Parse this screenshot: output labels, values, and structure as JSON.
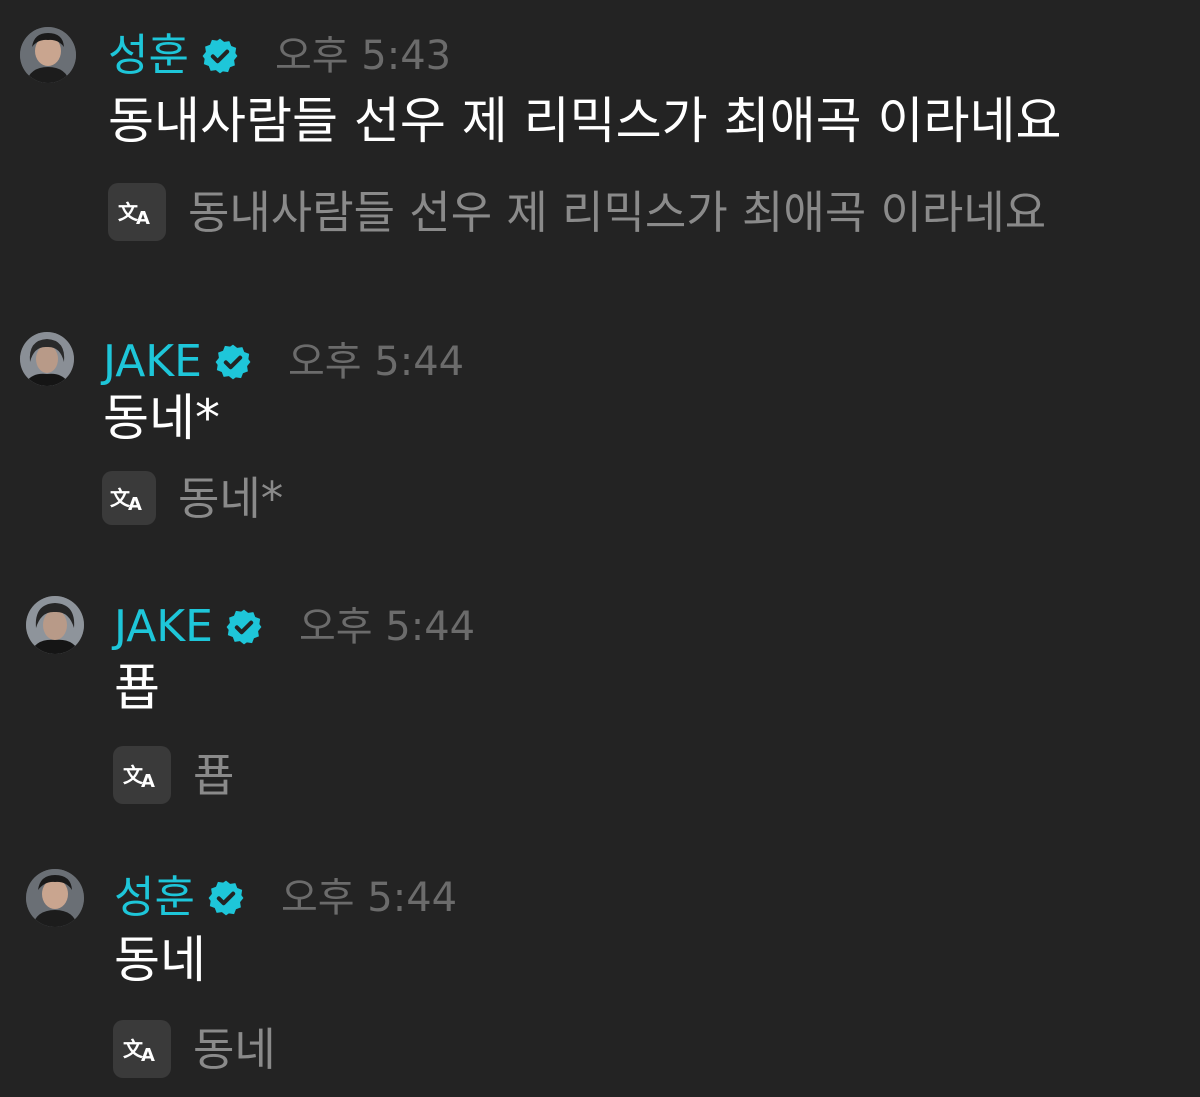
{
  "colors": {
    "background": "#232323",
    "username": "#1ec6d9",
    "verified_badge": "#1ec6d9",
    "timestamp": "#6b6b6b",
    "message_text": "#ffffff",
    "translation_text": "#8a8a8a",
    "translate_button_bg": "#3a3a3a"
  },
  "icons": {
    "verified": "verified-badge-icon",
    "translate": "translate-icon"
  },
  "messages": [
    {
      "username": "성훈",
      "time": "오후 5:43",
      "text": "동내사람들 선우 제 리믹스가 최애곡 이라네요",
      "translation": "동내사람들 선우 제 리믹스가 최애곡 이라네요"
    },
    {
      "username": "JAKE",
      "time": "오후 5:44",
      "text": "동네*",
      "translation": "동네*"
    },
    {
      "username": "JAKE",
      "time": "오후 5:44",
      "text": "푭",
      "translation": "푭"
    },
    {
      "username": "성훈",
      "time": "오후 5:44",
      "text": "동네",
      "translation": "동네"
    }
  ]
}
